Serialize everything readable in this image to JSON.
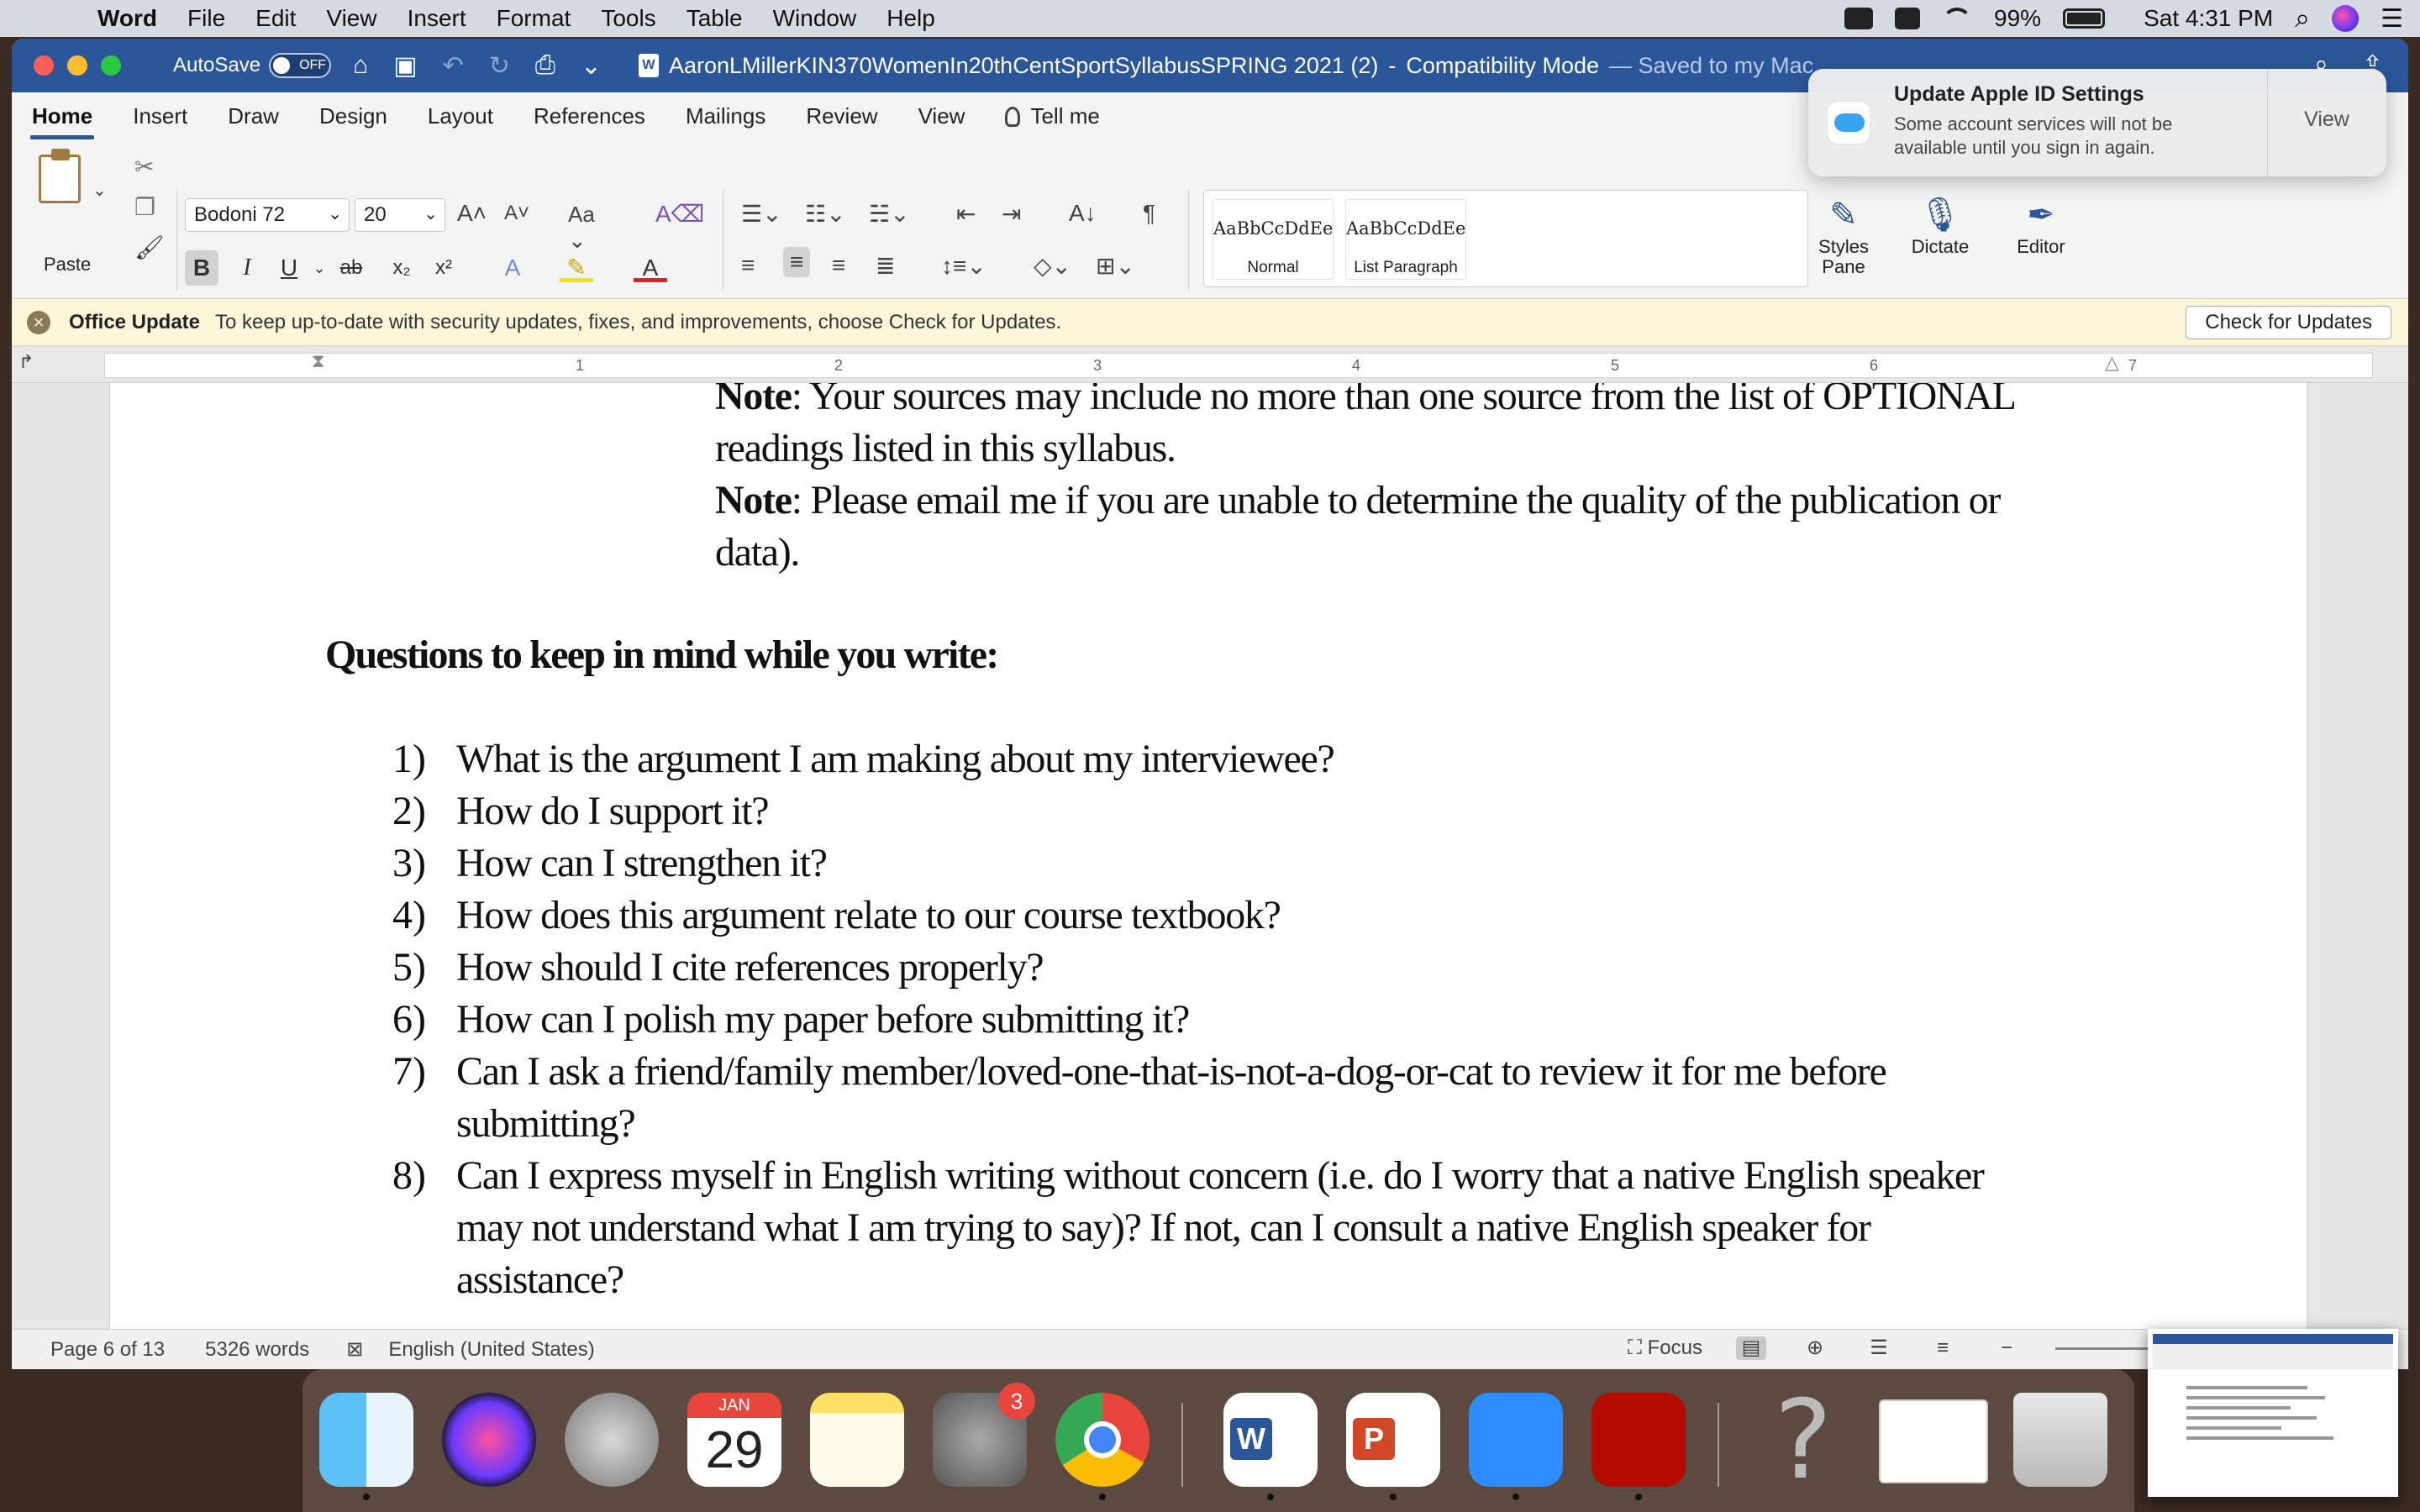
{
  "menubar": {
    "app": "Word",
    "items": [
      "File",
      "Edit",
      "View",
      "Insert",
      "Format",
      "Tools",
      "Table",
      "Window",
      "Help"
    ],
    "battery": "99%",
    "clock": "Sat 4:31 PM"
  },
  "titlebar": {
    "autosave_label": "AutoSave",
    "autosave_state": "OFF",
    "doc_name": "AaronLMillerKIN370WomenIn20thCentSportSyllabusSPRING 2021 (2)",
    "mode": "Compatibility Mode",
    "saved": "— Saved to my Mac",
    "mini_icon": "W"
  },
  "ribbon_tabs": [
    "Home",
    "Insert",
    "Draw",
    "Design",
    "Layout",
    "References",
    "Mailings",
    "Review",
    "View",
    "Tell me"
  ],
  "ribbon": {
    "paste_label": "Paste",
    "font_name": "Bodoni 72",
    "font_size": "20",
    "case_label": "Aa",
    "styles": [
      {
        "sample": "AaBbCcDdEe",
        "name": "Normal"
      },
      {
        "sample": "AaBbCcDdEe",
        "name": "List Paragraph"
      }
    ],
    "styles_pane": "Styles Pane",
    "dictate": "Dictate",
    "editor": "Editor"
  },
  "update_bar": {
    "title": "Office Update",
    "message": "To keep up-to-date with security updates, fixes, and improvements, choose Check for Updates.",
    "button": "Check for Updates"
  },
  "ruler_numbers": [
    "1",
    "2",
    "3",
    "4",
    "5",
    "6",
    "7"
  ],
  "document": {
    "note1_label": "Note",
    "note1_text": ": Your sources may include no more than one source from the list of OPTIONAL",
    "note1_cont": "readings listed in this syllabus.",
    "note2_label": "Note",
    "note2_text": ": Please email me if you are unable to determine the quality of the publication or",
    "note2_cont": "data).",
    "heading": "Questions to keep in mind while you write:",
    "questions": [
      {
        "num": "1)",
        "lines": [
          "What is the argument I am making about my interviewee?"
        ]
      },
      {
        "num": "2)",
        "lines": [
          "How do I support it?"
        ]
      },
      {
        "num": "3)",
        "lines": [
          "How can I strengthen it?"
        ]
      },
      {
        "num": "4)",
        "lines": [
          "How does this argument relate to our course textbook?"
        ]
      },
      {
        "num": "5)",
        "lines": [
          "How should I cite references properly?"
        ]
      },
      {
        "num": "6)",
        "lines": [
          "How can I polish my paper before submitting it?"
        ]
      },
      {
        "num": "7)",
        "lines": [
          "Can I ask a friend/family member/loved-one-that-is-not-a-dog-or-cat to review it for me before",
          "submitting?"
        ]
      },
      {
        "num": "8)",
        "lines": [
          "Can I express myself in English writing without concern (i.e. do I worry that a native English speaker",
          "may not understand what I am trying to say)? If not, can I consult a native English speaker for",
          "assistance?"
        ]
      }
    ]
  },
  "statusbar": {
    "page": "Page 6 of 13",
    "words": "5326 words",
    "language": "English (United States)",
    "focus": "Focus"
  },
  "notification": {
    "title": "Update Apple ID Settings",
    "body": "Some account services will not be available until you sign in again.",
    "button": "View"
  },
  "dock": {
    "calendar_month": "JAN",
    "calendar_day": "29",
    "prefs_badge": "3"
  },
  "colors": {
    "word_blue": "#2b579a",
    "update_bar": "#fdf6d8",
    "badge_red": "#e8453c"
  }
}
